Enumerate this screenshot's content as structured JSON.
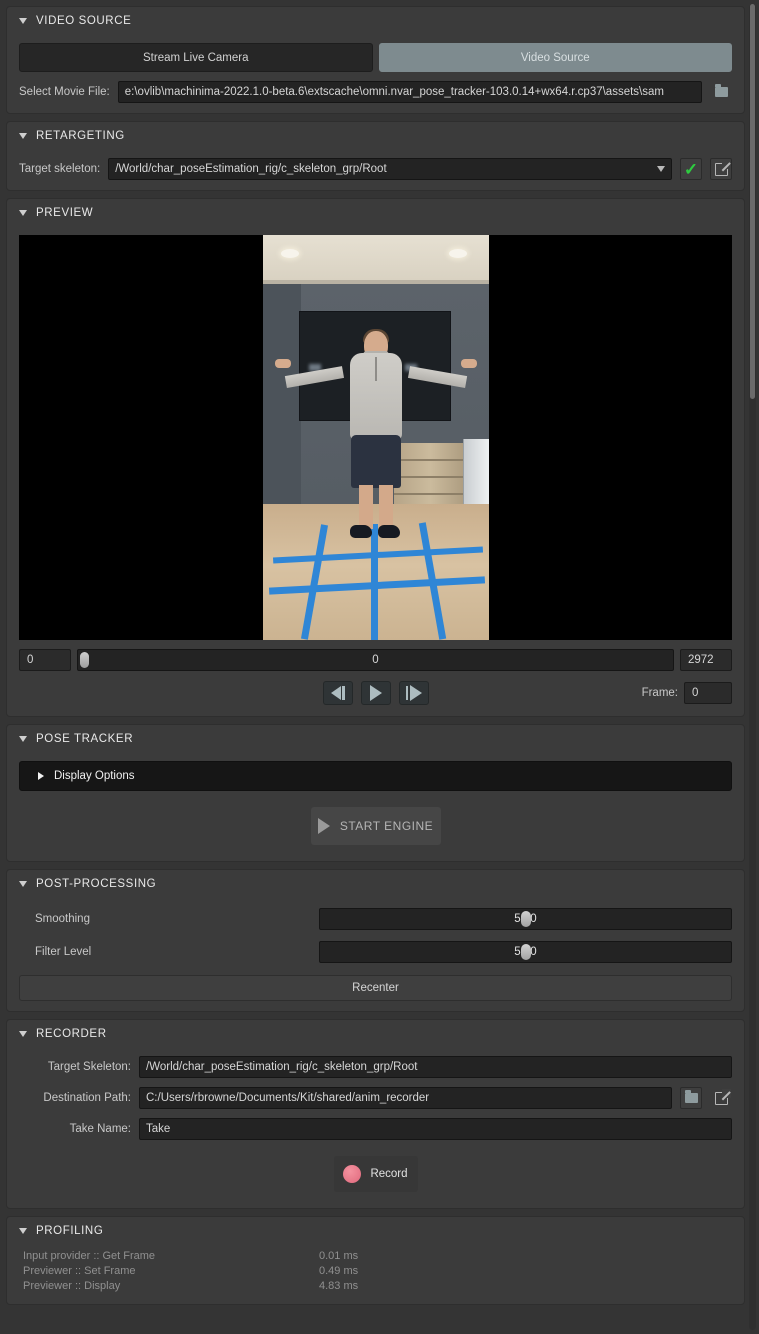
{
  "video_source": {
    "section_title": "VIDEO SOURCE",
    "tabs": [
      {
        "label": "Stream Live Camera",
        "active": false
      },
      {
        "label": "Video Source",
        "active": true
      }
    ],
    "movie_file_label": "Select Movie File:",
    "movie_file_value": "e:\\ovlib\\machinima-2022.1.0-beta.6\\extscache\\omni.nvar_pose_tracker-103.0.14+wx64.r.cp37\\assets\\sam",
    "browse_icon": "folder-icon"
  },
  "retargeting": {
    "section_title": "RETARGETING",
    "target_skeleton_label": "Target skeleton:",
    "target_skeleton_value": "/World/char_poseEstimation_rig/c_skeleton_grp/Root",
    "dropdown_icon": "chevron-down-icon",
    "confirm_icon": "check-icon",
    "confirm_color": "#2ecc40",
    "open_icon": "external-link-icon"
  },
  "preview": {
    "section_title": "PREVIEW",
    "timeline": {
      "start": "0",
      "current": "0",
      "end": "2972",
      "handle_percent": 0
    },
    "transport": {
      "prev_frame": "step-back-icon",
      "play": "play-icon",
      "next_frame": "step-forward-icon"
    },
    "frame_label": "Frame:",
    "frame_value": "0"
  },
  "pose_tracker": {
    "section_title": "POSE TRACKER",
    "display_options_label": "Display Options",
    "display_options_expanded": false,
    "start_engine_label": "START ENGINE"
  },
  "post_processing": {
    "section_title": "POST-PROCESSING",
    "sliders": [
      {
        "label": "Smoothing",
        "value": "50.0",
        "percent": 50
      },
      {
        "label": "Filter Level",
        "value": "50.0",
        "percent": 50
      }
    ],
    "recenter_label": "Recenter"
  },
  "recorder": {
    "section_title": "RECORDER",
    "fields": [
      {
        "label": "Target Skeleton:",
        "value": "/World/char_poseEstimation_rig/c_skeleton_grp/Root"
      },
      {
        "label": "Destination Path:",
        "value": "C:/Users/rbrowne/Documents/Kit/shared/anim_recorder"
      },
      {
        "label": "Take Name:",
        "value": "Take"
      }
    ],
    "browse_icon": "folder-icon",
    "open_icon": "external-link-icon",
    "record_label": "Record",
    "record_dot_color": "#e0697d"
  },
  "profiling": {
    "section_title": "PROFILING",
    "rows": [
      {
        "name": "Input provider :: Get Frame",
        "time": "0.01 ms"
      },
      {
        "name": "Previewer :: Set Frame",
        "time": "0.49 ms"
      },
      {
        "name": "Previewer :: Display",
        "time": "4.83 ms"
      }
    ]
  }
}
